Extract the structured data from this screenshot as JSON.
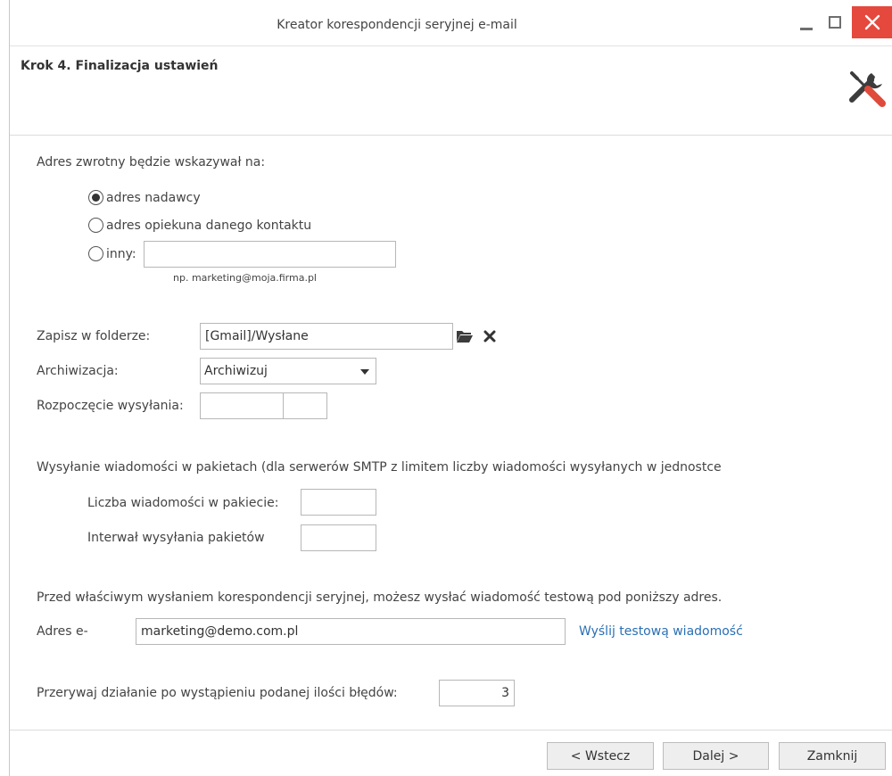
{
  "window": {
    "title": "Kreator korespondencji seryjnej e-mail",
    "controls": {
      "minimize": "minimize-icon",
      "maximize": "maximize-icon",
      "close": "close-icon"
    },
    "close_color": "#e5483d"
  },
  "header": {
    "step_title": "Krok 4. Finalizacja ustawień",
    "icon": "tools-icon"
  },
  "return_address": {
    "label": "Adres zwrotny będzie wskazywał na:",
    "options": [
      {
        "label": "adres nadawcy",
        "selected": true
      },
      {
        "label": "adres opiekuna danego kontaktu",
        "selected": false
      },
      {
        "label": "inny:",
        "selected": false
      }
    ],
    "other_value": "",
    "hint": "np. marketing@moja.firma.pl"
  },
  "folder": {
    "label": "Zapisz w folderze:",
    "value": "[Gmail]/Wysłane",
    "browse_icon": "folder-icon",
    "clear_icon": "close-x-icon"
  },
  "archive": {
    "label": "Archiwizacja:",
    "value": "Archiwizuj"
  },
  "start": {
    "label": "Rozpoczęcie wysyłania:",
    "date_value": "",
    "time_value": ""
  },
  "batches": {
    "label": "Wysyłanie wiadomości w pakietach (dla serwerów SMTP z limitem liczby wiadomości wysyłanych w jednostce",
    "count_label": "Liczba wiadomości w pakiecie:",
    "count_value": "",
    "interval_label": "Interwał wysyłania pakietów",
    "interval_value": ""
  },
  "test": {
    "label": "Przed właściwym wysłaniem korespondencji seryjnej, możesz wysłać wiadomość testową pod poniższy adres.",
    "email_label": "Adres e-",
    "email_value": "marketing@demo.com.pl",
    "send_link": "Wyślij testową wiadomość",
    "link_color": "#2a6fb5"
  },
  "errors": {
    "label": "Przerywaj działanie po wystąpieniu podanej ilości błędów:",
    "value": "3"
  },
  "footer": {
    "back": "< Wstecz",
    "next": "Dalej >",
    "close": "Zamknij"
  }
}
